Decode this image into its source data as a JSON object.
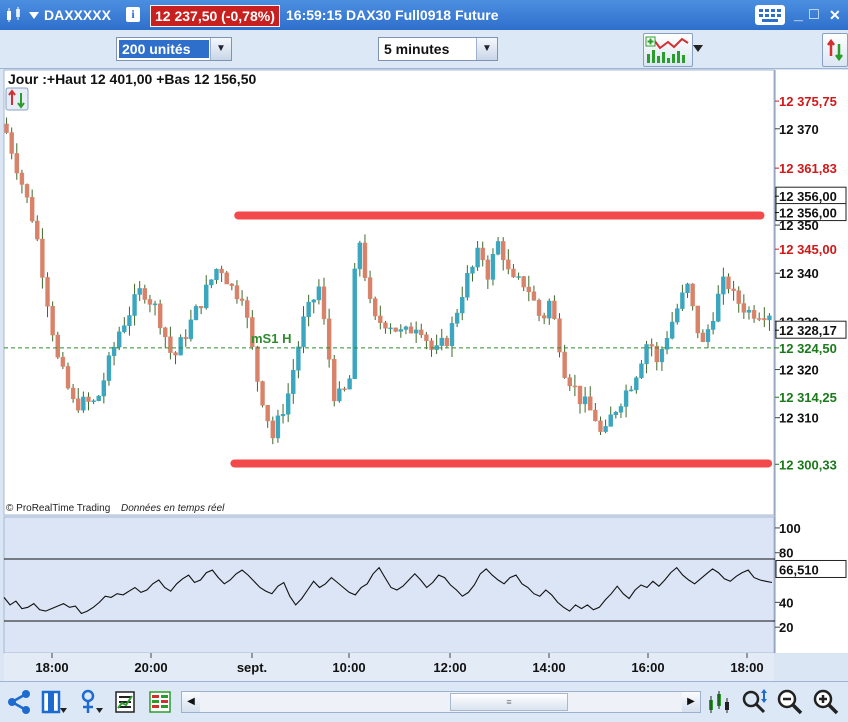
{
  "titlebar": {
    "instrument": "DAXXXXX",
    "price_change": "12 237,50 (-0,78%)",
    "time": "16:59:15",
    "contract": "DAX30 Full0918 Future",
    "info_glyph": "i",
    "minimize": "_",
    "restore": "□",
    "close": "✕"
  },
  "toolbar": {
    "units": "200 unités",
    "timeframe": "5 minutes"
  },
  "chart_header": {
    "text": "Jour :+Haut 12 401,00 +Bas 12 156,50"
  },
  "watermark": {
    "brand": "© ProRealTime Trading",
    "status": "Données en temps réel"
  },
  "chart_data": [
    {
      "type": "candlestick",
      "title": "Jour :+Haut 12 401,00 +Bas 12 156,50",
      "ylim": [
        12290,
        12382
      ],
      "y_ticks": [
        12310,
        12320,
        12330,
        12340,
        12350,
        12370
      ],
      "y_tick_labels": [
        "12 310",
        "12 320",
        "12 330",
        "12 340",
        "12 350",
        "12 370"
      ],
      "x_ticks": [
        "18:00",
        "20:00",
        "sept.",
        "10:00",
        "12:00",
        "14:00",
        "16:00",
        "18:00"
      ],
      "price_labels": [
        {
          "label": "12 375,75",
          "value": 12375.75,
          "color": "#d01818",
          "boxed": false
        },
        {
          "label": "12 361,83",
          "value": 12361.83,
          "color": "#d01818",
          "boxed": false
        },
        {
          "label": "12 356,00",
          "value": 12356.0,
          "color": "#111111",
          "boxed": true
        },
        {
          "label": "12 356,00",
          "value": 12352.6,
          "color": "#111111",
          "boxed": true
        },
        {
          "label": "12 345,00",
          "value": 12345.0,
          "color": "#d01818",
          "boxed": false
        },
        {
          "label": "12 328,17",
          "value": 12328.17,
          "color": "#111111",
          "boxed": true
        },
        {
          "label": "12 324,50",
          "value": 12324.5,
          "color": "#1a7a1a",
          "boxed": false
        },
        {
          "label": "12 314,25",
          "value": 12314.25,
          "color": "#1a7a1a",
          "boxed": false
        },
        {
          "label": "12 300,33",
          "value": 12300.33,
          "color": "#1a7a1a",
          "boxed": false
        }
      ],
      "pivot_line": {
        "label": "mS1 H",
        "value": 12324.5
      },
      "resistance_line": {
        "from_x": 0.305,
        "to_x": 0.985,
        "value": 12352.0
      },
      "support_line": {
        "from_x": 0.3,
        "to_x": 0.995,
        "value": 12300.5
      },
      "colors": {
        "up": "#3aa6bf",
        "down": "#d9826a",
        "resistance": "#f24a4a",
        "support": "#f24a4a",
        "pivot": "#2e8b2e"
      },
      "close_path": [
        [
          0.0,
          12371
        ],
        [
          0.04,
          12350
        ],
        [
          0.07,
          12322
        ],
        [
          0.09,
          12313
        ],
        [
          0.12,
          12313
        ],
        [
          0.15,
          12328
        ],
        [
          0.18,
          12337
        ],
        [
          0.2,
          12332
        ],
        [
          0.22,
          12322
        ],
        [
          0.25,
          12332
        ],
        [
          0.28,
          12342
        ],
        [
          0.3,
          12336
        ],
        [
          0.31,
          12336
        ],
        [
          0.33,
          12318
        ],
        [
          0.35,
          12306
        ],
        [
          0.37,
          12315
        ],
        [
          0.39,
          12330
        ],
        [
          0.41,
          12337
        ],
        [
          0.43,
          12315
        ],
        [
          0.44,
          12314
        ],
        [
          0.45,
          12318
        ],
        [
          0.46,
          12350
        ],
        [
          0.47,
          12340
        ],
        [
          0.48,
          12330
        ],
        [
          0.5,
          12330
        ],
        [
          0.52,
          12327
        ],
        [
          0.54,
          12330
        ],
        [
          0.56,
          12323
        ],
        [
          0.58,
          12327
        ],
        [
          0.6,
          12338
        ],
        [
          0.61,
          12341
        ],
        [
          0.62,
          12345
        ],
        [
          0.63,
          12340
        ],
        [
          0.645,
          12347
        ],
        [
          0.66,
          12338
        ],
        [
          0.68,
          12338
        ],
        [
          0.7,
          12330
        ],
        [
          0.71,
          12334
        ],
        [
          0.72,
          12328
        ],
        [
          0.73,
          12320
        ],
        [
          0.75,
          12314
        ],
        [
          0.77,
          12310
        ],
        [
          0.78,
          12305
        ],
        [
          0.79,
          12310
        ],
        [
          0.8,
          12313
        ],
        [
          0.82,
          12318
        ],
        [
          0.84,
          12327
        ],
        [
          0.85,
          12321
        ],
        [
          0.86,
          12326
        ],
        [
          0.88,
          12334
        ],
        [
          0.89,
          12337
        ],
        [
          0.9,
          12330
        ],
        [
          0.91,
          12325
        ],
        [
          0.92,
          12330
        ],
        [
          0.93,
          12335
        ],
        [
          0.94,
          12339
        ],
        [
          0.95,
          12335
        ],
        [
          0.97,
          12332
        ],
        [
          0.99,
          12332
        ],
        [
          1.0,
          12332
        ]
      ]
    },
    {
      "type": "line",
      "ylim": [
        0,
        108
      ],
      "y_ticks": [
        20,
        40,
        80,
        100
      ],
      "y_tick_labels": [
        "20",
        "40",
        "80",
        "100"
      ],
      "levels": [
        25,
        75
      ],
      "last_value_label": "66,510",
      "last_value": 66.51,
      "series": [
        {
          "values": [
            44,
            38,
            41,
            35,
            36,
            39,
            34,
            33,
            35,
            37,
            39,
            36,
            37,
            31,
            33,
            36,
            40,
            45,
            44,
            47,
            46,
            49,
            52,
            48,
            50,
            55,
            58,
            52,
            49,
            55,
            59,
            62,
            56,
            58,
            64,
            66,
            60,
            55,
            58,
            63,
            66,
            62,
            57,
            52,
            49,
            47,
            53,
            56,
            45,
            38,
            43,
            50,
            57,
            52,
            55,
            60,
            56,
            52,
            48,
            46,
            52,
            55,
            63,
            68,
            60,
            52,
            50,
            53,
            58,
            63,
            58,
            52,
            56,
            62,
            60,
            54,
            50,
            45,
            48,
            54,
            63,
            67,
            62,
            58,
            55,
            60,
            62,
            55,
            52,
            47,
            45,
            50,
            46,
            40,
            36,
            33,
            38,
            35,
            38,
            34,
            36,
            42,
            47,
            53,
            47,
            43,
            50,
            54,
            52,
            57,
            53,
            58,
            64,
            68,
            62,
            58,
            55,
            59,
            63,
            67,
            64,
            59,
            57,
            61,
            64,
            66,
            60,
            58,
            57,
            56
          ]
        }
      ]
    }
  ]
}
